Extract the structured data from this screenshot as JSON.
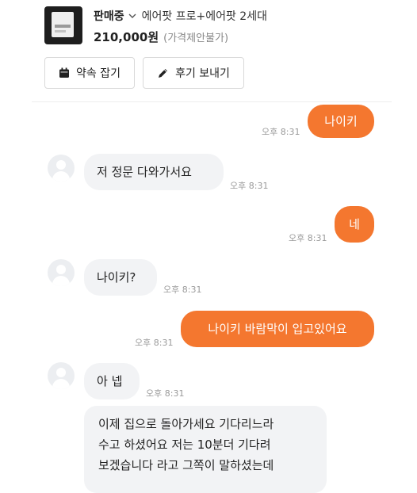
{
  "header": {
    "status": "판매중",
    "title": "에어팟 프로+에어팟 2세대",
    "price": "210,000원",
    "price_note": "(가격제안불가)",
    "buttons": {
      "appointment": "약속 잡기",
      "review": "후기 보내기"
    }
  },
  "messages": [
    {
      "side": "mine",
      "text": "나이키",
      "time": "오후 8:31"
    },
    {
      "side": "theirs",
      "text": "저 정문 다와가서요",
      "time": "오후 8:31"
    },
    {
      "side": "mine",
      "text": "네",
      "time": "오후 8:31"
    },
    {
      "side": "theirs",
      "text": "나이키?",
      "time": "오후 8:31"
    },
    {
      "side": "mine",
      "text": "나이키 바람막이 입고있어요",
      "time": "오후 8:31"
    },
    {
      "side": "theirs",
      "text": "아 넵",
      "time": "오후 8:31"
    },
    {
      "side": "theirs",
      "lines": [
        "이제 집으로 돌아가세요 기다리느라",
        "수고 하셨어요 저는 10분더 기다려",
        "보겠습니다 라고 그쪽이 말하셨는데"
      ]
    }
  ],
  "colors": {
    "accent": "#f4772f",
    "incoming_bubble": "#f2f3f5",
    "timestamp": "#9a9a9a"
  }
}
